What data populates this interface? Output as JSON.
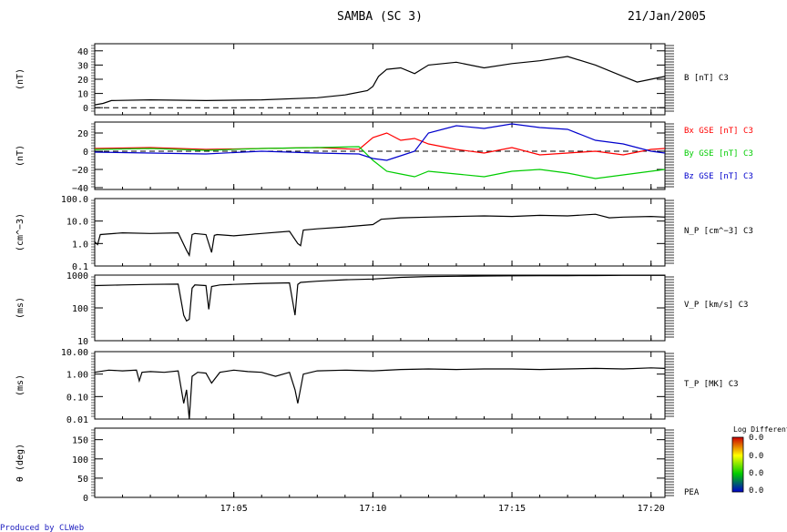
{
  "header": {
    "title": "SAMBA (SC 3)",
    "date": "21/Jan/2005",
    "credit": "Produced by CLWeb"
  },
  "x_axis": {
    "start": "17:00:00",
    "end": "17:20:30",
    "tick_labels": [
      "17:05",
      "17:10",
      "17:15",
      "17:20"
    ],
    "tick_times": [
      "17:05",
      "17:10",
      "17:15",
      "17:20"
    ]
  },
  "colorbar": {
    "title": "Log Differential",
    "tick_labels": [
      "0.0",
      "0.0",
      "0.0",
      "0.0"
    ],
    "colors": [
      "#cc0000",
      "#ffff00",
      "#00cc00",
      "#0000cc"
    ]
  },
  "chart_data": [
    {
      "type": "line",
      "name": "panel-b",
      "ylabel": "(nT)",
      "ylim": [
        -5,
        45
      ],
      "scale": "linear",
      "yticks": [
        "0",
        "10",
        "20",
        "30",
        "40"
      ],
      "ytick_values": [
        0,
        10,
        20,
        30,
        40
      ],
      "zero_line": true,
      "series": [
        {
          "name": "B [nT] C3",
          "color": "#000000",
          "x": [
            0.0,
            0.3,
            0.6,
            2.0,
            4.0,
            6.0,
            8.0,
            9.0,
            9.8,
            10.0,
            10.2,
            10.5,
            11.0,
            11.5,
            12.0,
            13.0,
            14.0,
            15.0,
            16.0,
            17.0,
            18.0,
            19.0,
            19.5,
            20.0,
            20.5
          ],
          "y": [
            2.0,
            3.0,
            5.0,
            5.5,
            5.0,
            5.5,
            7.0,
            9.0,
            12.0,
            15.0,
            22.0,
            27.0,
            28.0,
            24.0,
            30.0,
            32.0,
            28.0,
            31.0,
            33.0,
            36.0,
            30.0,
            22.0,
            18.0,
            20.0,
            22.0
          ]
        }
      ]
    },
    {
      "type": "line",
      "name": "panel-bxyz",
      "ylabel": "(nT)",
      "ylim": [
        -42,
        32
      ],
      "scale": "linear",
      "yticks": [
        "−40",
        "−20",
        "0",
        "20"
      ],
      "ytick_values": [
        -40,
        -20,
        0,
        20
      ],
      "zero_line": true,
      "series": [
        {
          "name": "Bx GSE [nT] C3",
          "color": "#ff0000",
          "x": [
            0,
            2,
            4,
            6,
            8,
            9.5,
            10.0,
            10.5,
            11.0,
            11.5,
            12.0,
            13.0,
            14.0,
            15.0,
            16.0,
            17.0,
            18.0,
            19.0,
            20.0,
            20.5
          ],
          "y": [
            3,
            4,
            2,
            3,
            4,
            2,
            15,
            20,
            12,
            14,
            8,
            2,
            -2,
            4,
            -4,
            -2,
            0,
            -4,
            2,
            3
          ]
        },
        {
          "name": "By GSE [nT] C3",
          "color": "#00cc00",
          "x": [
            0,
            2,
            4,
            6,
            8,
            9.5,
            10.0,
            10.5,
            11.0,
            11.5,
            12.0,
            13.0,
            14.0,
            15.0,
            16.0,
            17.0,
            18.0,
            19.0,
            20.0,
            20.5
          ],
          "y": [
            2,
            3,
            1,
            3,
            4,
            5,
            -10,
            -22,
            -25,
            -28,
            -22,
            -25,
            -28,
            -22,
            -20,
            -24,
            -30,
            -26,
            -22,
            -20
          ]
        },
        {
          "name": "Bz GSE [nT] C3",
          "color": "#0000cc",
          "x": [
            0,
            2,
            4,
            6,
            8,
            9.5,
            10.0,
            10.5,
            11.0,
            11.5,
            12.0,
            13.0,
            14.0,
            15.0,
            16.0,
            17.0,
            18.0,
            19.0,
            20.0,
            20.5
          ],
          "y": [
            -1,
            -2,
            -3,
            0,
            -2,
            -3,
            -8,
            -10,
            -5,
            0,
            20,
            28,
            25,
            30,
            26,
            24,
            12,
            8,
            0,
            -2
          ]
        }
      ]
    },
    {
      "type": "line",
      "name": "panel-np",
      "ylabel": "(cm^−3)",
      "ylim": [
        0.1,
        100
      ],
      "scale": "log",
      "yticks": [
        "0.1",
        "1.0",
        "10.0",
        "100.0"
      ],
      "ytick_values": [
        0.1,
        1,
        10,
        100
      ],
      "series": [
        {
          "name": "N_P [cm^−3] C3",
          "color": "#000000",
          "x": [
            0.0,
            0.1,
            0.2,
            1.0,
            2.0,
            3.0,
            3.3,
            3.4,
            3.5,
            3.6,
            4.0,
            4.2,
            4.3,
            4.4,
            5.0,
            6.0,
            7.0,
            7.3,
            7.4,
            7.5,
            8.0,
            9.0,
            10.0,
            10.3,
            11.0,
            12.0,
            13.0,
            14.0,
            15.0,
            16.0,
            17.0,
            18.0,
            18.5,
            19.0,
            20.0,
            20.5
          ],
          "y": [
            1.2,
            0.9,
            2.5,
            3.0,
            2.8,
            3.0,
            0.5,
            0.3,
            2.5,
            2.8,
            2.5,
            0.4,
            2.3,
            2.5,
            2.2,
            2.8,
            3.5,
            1.0,
            0.8,
            4.0,
            4.5,
            5.5,
            7.0,
            12.0,
            14.0,
            15.0,
            16.0,
            17.0,
            16.0,
            18.0,
            17.0,
            20.0,
            14.0,
            15.0,
            16.0,
            15.0
          ]
        }
      ]
    },
    {
      "type": "line",
      "name": "panel-vp",
      "ylabel": "(ms)",
      "ylim": [
        10,
        1000
      ],
      "scale": "log",
      "yticks": [
        "10",
        "100",
        "1000"
      ],
      "ytick_values": [
        10,
        100,
        1000
      ],
      "series": [
        {
          "name": "V_P [km/s] C3",
          "color": "#000000",
          "x": [
            0.0,
            1.0,
            2.0,
            3.0,
            3.2,
            3.3,
            3.4,
            3.5,
            3.6,
            4.0,
            4.1,
            4.2,
            4.5,
            5.0,
            6.0,
            7.0,
            7.2,
            7.3,
            7.4,
            8.0,
            9.0,
            10.0,
            11.0,
            12.0,
            13.0,
            14.0,
            15.0,
            16.0,
            17.0,
            18.0,
            19.0,
            20.0,
            20.5
          ],
          "y": [
            480,
            500,
            520,
            530,
            60,
            40,
            45,
            400,
            500,
            480,
            90,
            450,
            500,
            520,
            560,
            580,
            60,
            520,
            600,
            650,
            720,
            760,
            850,
            900,
            920,
            940,
            950,
            960,
            960,
            970,
            980,
            980,
            980
          ]
        }
      ]
    },
    {
      "type": "line",
      "name": "panel-tp",
      "ylabel": "(ms)",
      "ylim": [
        0.01,
        10
      ],
      "scale": "log",
      "yticks": [
        "0.01",
        "0.10",
        "1.00",
        "10.00"
      ],
      "ytick_values": [
        0.01,
        0.1,
        1,
        10
      ],
      "series": [
        {
          "name": "T_P [MK] C3",
          "color": "#000000",
          "x": [
            0.0,
            0.5,
            1.0,
            1.5,
            1.6,
            1.7,
            2.0,
            2.5,
            3.0,
            3.2,
            3.3,
            3.4,
            3.5,
            3.7,
            4.0,
            4.2,
            4.5,
            5.0,
            5.5,
            6.0,
            6.5,
            7.0,
            7.2,
            7.3,
            7.5,
            8.0,
            9.0,
            10.0,
            11.0,
            12.0,
            13.0,
            14.0,
            15.0,
            16.0,
            17.0,
            18.0,
            19.0,
            20.0,
            20.5
          ],
          "y": [
            1.2,
            1.5,
            1.4,
            1.5,
            0.5,
            1.2,
            1.3,
            1.2,
            1.4,
            0.05,
            0.2,
            0.01,
            0.8,
            1.2,
            1.1,
            0.4,
            1.2,
            1.5,
            1.3,
            1.2,
            0.8,
            1.2,
            0.2,
            0.05,
            1.0,
            1.4,
            1.5,
            1.4,
            1.6,
            1.7,
            1.6,
            1.7,
            1.7,
            1.6,
            1.7,
            1.8,
            1.7,
            1.9,
            1.8
          ]
        }
      ]
    },
    {
      "type": "heatmap",
      "name": "panel-pea",
      "ylabel": "θ (deg)",
      "ylim": [
        0,
        180
      ],
      "scale": "linear",
      "yticks": [
        "0",
        "50",
        "100",
        "150"
      ],
      "ytick_values": [
        0,
        50,
        100,
        150
      ],
      "series": [
        {
          "name": "PEA",
          "color": "#000000",
          "x": [],
          "y": []
        }
      ]
    }
  ]
}
